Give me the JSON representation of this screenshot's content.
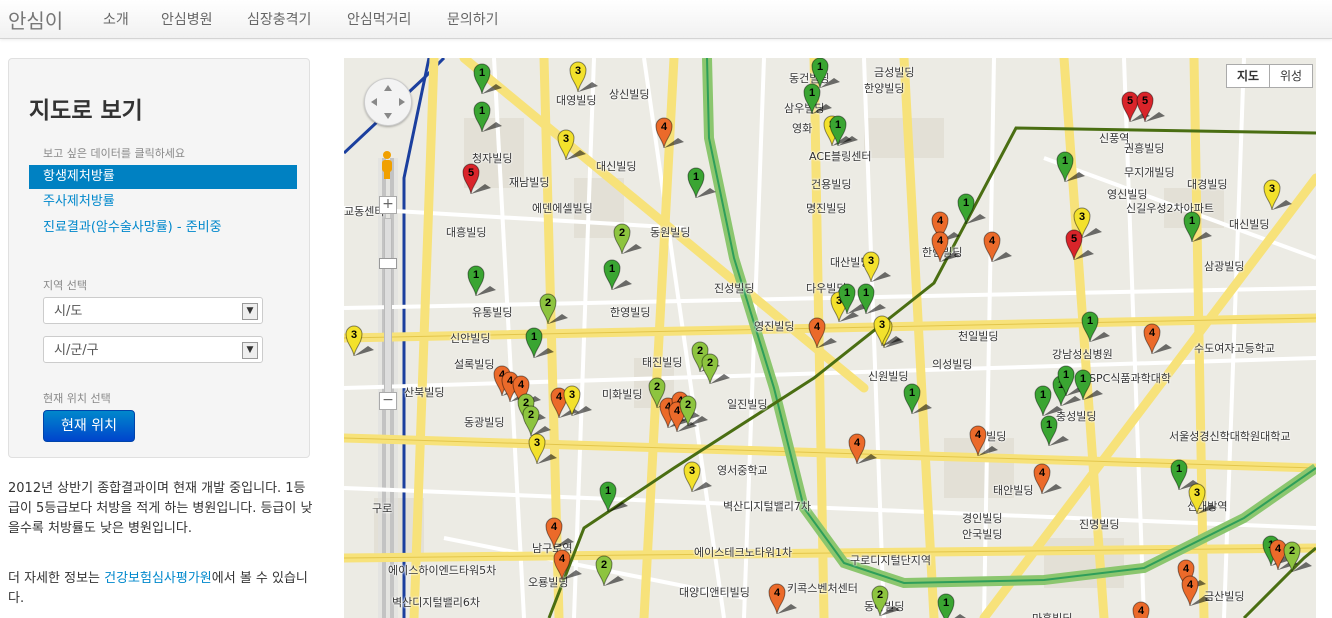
{
  "nav": {
    "brand": "안심이",
    "items": [
      "소개",
      "안심병원",
      "심장충격기",
      "안심먹거리",
      "문의하기"
    ]
  },
  "sidebar": {
    "title": "지도로 보기",
    "data_prompt": "보고 싶은 데이터를 클릭하세요",
    "data_items": [
      "항생제처방률",
      "주사제처방률",
      "진료결과(암수술사망률) - 준비중"
    ],
    "region_label": "지역 선택",
    "province_select": "시/도",
    "city_select": "시/군/구",
    "location_label": "현재 위치 선택",
    "location_button": "현재 위치"
  },
  "info": {
    "paragraph1": "2012년 상반기 종합결과이며 현재 개발 중입니다. 1등급이 5등급보다 처방을 적게 하는 병원입니다. 등급이 낮을수록 처방률도 낮은 병원입니다.",
    "paragraph2_prefix": "더 자세한 정보는 ",
    "paragraph2_link": "건강보험심사평가원",
    "paragraph2_suffix": "에서 볼 수 있습니다."
  },
  "map": {
    "type_map": "지도",
    "type_satellite": "위성",
    "labels": [
      "동건빌딩",
      "금성빌딩",
      "대영빌딩",
      "상신빌딩",
      "한양빌딩",
      "삼우빌딩",
      "영화",
      "신풍역",
      "권흥빌딩",
      "청자빌딩",
      "대신빌딩",
      "ACE블링센터",
      "무지개빌딩",
      "대경빌딩",
      "재남빌딩",
      "건용빌딩",
      "영신빌딩",
      "신길우성2차아파트",
      "에덴에셀빌딩",
      "명진빌딩",
      "대신빌딩",
      "교동센터",
      "대흥빌딩",
      "동원빌딩",
      "한림빌딩",
      "삼광빌딩",
      "대산빌딩",
      "다우빌딩",
      "진성빌딩",
      "유통빌딩",
      "한영빌딩",
      "영진빌딩",
      "신안빌딩",
      "설록빌딩",
      "천일빌딩",
      "강남성심병원",
      "태진빌딩",
      "수도여자고등학교",
      "신원빌딩",
      "미화빌딩",
      "의성빌딩",
      "SPC식품과학대학",
      "산북빌딩",
      "동광빌딩",
      "일진빌딩",
      "충성빌딩",
      "서울성경신학대학원대학교",
      "상빌딩",
      "영서중학교",
      "태안빌딩",
      "벽산디지털밸리7차",
      "경인빌딩",
      "신대방역",
      "안국빌딩",
      "진명빌딩",
      "구로",
      "에이스하이엔드타워5차",
      "에이스테크노타워1차",
      "구로디지털단지역",
      "남구로역",
      "오룡빌딩",
      "대양디앤티빌딩",
      "키콕스벤처센터",
      "벽산디지털밸리6차",
      "금산빌딩",
      "마흥빌딩",
      "동아빌딩"
    ],
    "markers": [
      {
        "grade": "1",
        "color": "#3aa532"
      },
      {
        "grade": "1",
        "color": "#3aa532"
      },
      {
        "grade": "3",
        "color": "#f3e12c"
      },
      {
        "grade": "1",
        "color": "#3aa532"
      },
      {
        "grade": "1",
        "color": "#3aa532"
      },
      {
        "grade": "3",
        "color": "#f3e12c"
      },
      {
        "grade": "1",
        "color": "#3aa532"
      },
      {
        "grade": "5",
        "color": "#d9242a"
      },
      {
        "grade": "5",
        "color": "#d9242a"
      },
      {
        "grade": "3",
        "color": "#f3e12c"
      },
      {
        "grade": "4",
        "color": "#eb6a2a"
      },
      {
        "grade": "1",
        "color": "#3aa532"
      },
      {
        "grade": "5",
        "color": "#d9242a"
      },
      {
        "grade": "1",
        "color": "#3aa532"
      },
      {
        "grade": "3",
        "color": "#f3e12c"
      },
      {
        "grade": "1",
        "color": "#3aa532"
      },
      {
        "grade": "4",
        "color": "#eb6a2a"
      },
      {
        "grade": "3",
        "color": "#f3e12c"
      },
      {
        "grade": "2",
        "color": "#8dc43f"
      },
      {
        "grade": "4",
        "color": "#eb6a2a"
      },
      {
        "grade": "4",
        "color": "#eb6a2a"
      },
      {
        "grade": "5",
        "color": "#d9242a"
      },
      {
        "grade": "3",
        "color": "#f3e12c"
      },
      {
        "grade": "1",
        "color": "#3aa532"
      },
      {
        "grade": "1",
        "color": "#3aa532"
      },
      {
        "grade": "3",
        "color": "#f3e12c"
      },
      {
        "grade": "1",
        "color": "#3aa532"
      },
      {
        "grade": "2",
        "color": "#8dc43f"
      },
      {
        "grade": "1",
        "color": "#3aa532"
      },
      {
        "grade": "1",
        "color": "#3aa532"
      },
      {
        "grade": "3",
        "color": "#f3e12c"
      },
      {
        "grade": "4",
        "color": "#eb6a2a"
      },
      {
        "grade": "3",
        "color": "#f3e12c"
      },
      {
        "grade": "1",
        "color": "#3aa532"
      },
      {
        "grade": "4",
        "color": "#eb6a2a"
      },
      {
        "grade": "3",
        "color": "#f3e12c"
      },
      {
        "grade": "1",
        "color": "#3aa532"
      },
      {
        "grade": "2",
        "color": "#8dc43f"
      },
      {
        "grade": "2",
        "color": "#8dc43f"
      },
      {
        "grade": "2",
        "color": "#8dc43f"
      },
      {
        "grade": "4",
        "color": "#eb6a2a"
      },
      {
        "grade": "4",
        "color": "#eb6a2a"
      },
      {
        "grade": "4",
        "color": "#eb6a2a"
      },
      {
        "grade": "2",
        "color": "#8dc43f"
      },
      {
        "grade": "1",
        "color": "#3aa532"
      },
      {
        "grade": "1",
        "color": "#3aa532"
      },
      {
        "grade": "4",
        "color": "#eb6a2a"
      },
      {
        "grade": "2",
        "color": "#8dc43f"
      },
      {
        "grade": "4",
        "color": "#eb6a2a"
      },
      {
        "grade": "4",
        "color": "#eb6a2a"
      },
      {
        "grade": "4",
        "color": "#eb6a2a"
      },
      {
        "grade": "3",
        "color": "#f3e12c"
      },
      {
        "grade": "2",
        "color": "#8dc43f"
      },
      {
        "grade": "3",
        "color": "#f3e12c"
      },
      {
        "grade": "1",
        "color": "#3aa532"
      },
      {
        "grade": "1",
        "color": "#3aa532"
      },
      {
        "grade": "1",
        "color": "#3aa532"
      },
      {
        "grade": "1",
        "color": "#3aa532"
      },
      {
        "grade": "4",
        "color": "#eb6a2a"
      },
      {
        "grade": "1",
        "color": "#3aa532"
      },
      {
        "grade": "4",
        "color": "#eb6a2a"
      },
      {
        "grade": "4",
        "color": "#eb6a2a"
      },
      {
        "grade": "3",
        "color": "#f3e12c"
      },
      {
        "grade": "3",
        "color": "#f3e12c"
      },
      {
        "grade": "1",
        "color": "#3aa532"
      },
      {
        "grade": "4",
        "color": "#eb6a2a"
      },
      {
        "grade": "2",
        "color": "#8dc43f"
      },
      {
        "grade": "4",
        "color": "#eb6a2a"
      },
      {
        "grade": "4",
        "color": "#eb6a2a"
      },
      {
        "grade": "1",
        "color": "#3aa532"
      },
      {
        "grade": "4",
        "color": "#eb6a2a"
      },
      {
        "grade": "4",
        "color": "#eb6a2a"
      },
      {
        "grade": "2",
        "color": "#8dc43f"
      },
      {
        "grade": "2",
        "color": "#8dc43f"
      },
      {
        "grade": "1",
        "color": "#3aa532"
      },
      {
        "grade": "4",
        "color": "#eb6a2a"
      },
      {
        "grade": "4",
        "color": "#eb6a2a"
      }
    ]
  }
}
